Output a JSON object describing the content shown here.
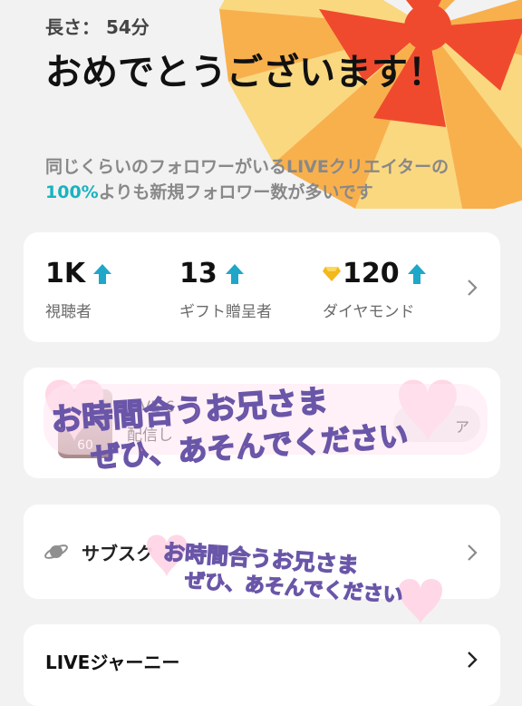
{
  "header": {
    "duration": "長さ： 54分",
    "headline": "おめでとうございます！",
    "sub_before": "同じくらいのフォロワーがいるLIVEクリエイターの",
    "sub_pct": "100%",
    "sub_after": "よりも新規フォロワー数が多いです"
  },
  "stats": [
    {
      "value": "1K",
      "label": "視聴者",
      "icon": "up-arrow-icon"
    },
    {
      "value": "13",
      "label": "ギフト贈呈者",
      "icon": "up-arrow-icon"
    },
    {
      "value": "120",
      "label": "ダイヤモンド",
      "icon": "up-arrow-icon"
    }
  ],
  "video_card": {
    "thumb_number": "60",
    "line1": "LIVE 6",
    "line2": "配信し",
    "share_label": "ア"
  },
  "subscription": {
    "label": "サブスク"
  },
  "journey": {
    "label": "LIVEジャーニー"
  },
  "stickers": [
    {
      "line1": "お時間合うお兄さま",
      "line2": "ぜひ、あそんでください"
    },
    {
      "line1": "お時間合うお兄さま",
      "line2": "ぜひ、あそんでください"
    }
  ],
  "colors": {
    "accent": "#18b3c1",
    "arrow": "#1ea7c8",
    "burst_red": "#ef4a2e",
    "burst_orange": "#f9a530",
    "burst_yellow": "#fcd36b"
  }
}
